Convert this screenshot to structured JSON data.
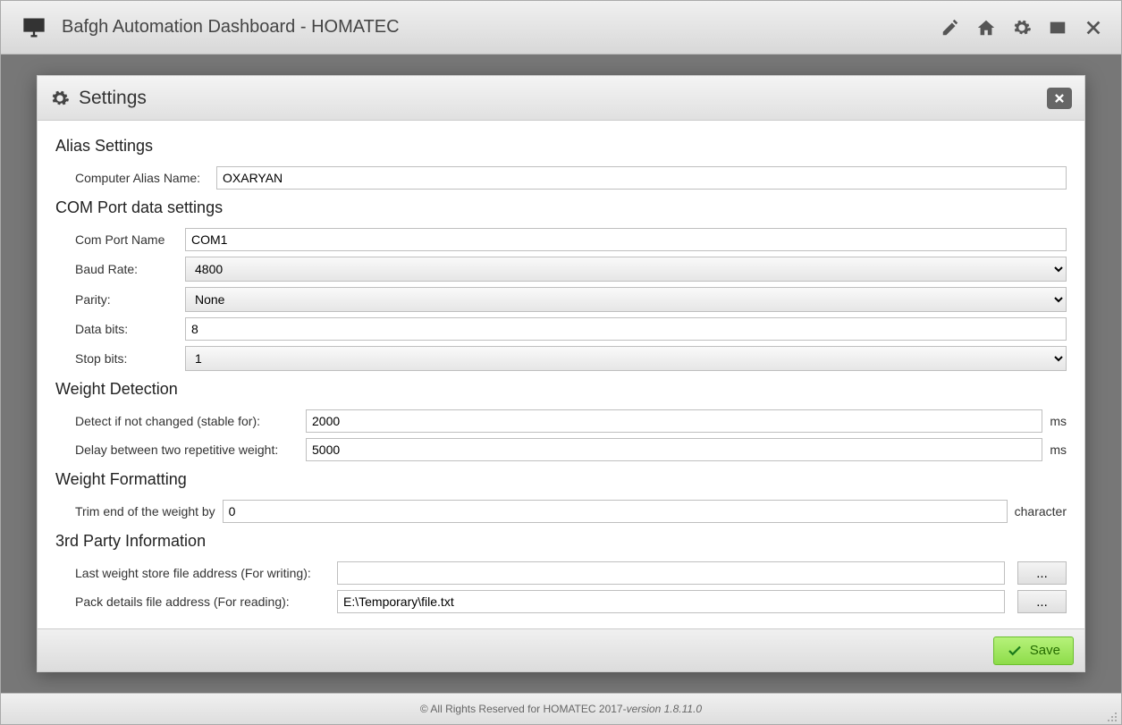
{
  "app": {
    "title": "Bafgh Automation Dashboard - HOMATEC"
  },
  "toolbar_icons": {
    "pencil": "pencil-icon",
    "home": "home-icon",
    "gear": "gear-icon",
    "window": "window-icon",
    "close": "close-icon"
  },
  "modal": {
    "title": "Settings",
    "sections": {
      "alias": {
        "heading": "Alias Settings",
        "computer_alias_label": "Computer Alias Name:",
        "computer_alias_value": "OXARYAN"
      },
      "comport": {
        "heading": "COM Port data settings",
        "port_name_label": "Com Port Name",
        "port_name_value": "COM1",
        "baud_label": "Baud Rate:",
        "baud_value": "4800",
        "parity_label": "Parity:",
        "parity_value": "None",
        "databits_label": "Data bits:",
        "databits_value": "8",
        "stopbits_label": "Stop bits:",
        "stopbits_value": "1"
      },
      "detection": {
        "heading": "Weight Detection",
        "stable_label": "Detect if not changed (stable for):",
        "stable_value": "2000",
        "stable_unit": "ms",
        "delay_label": "Delay between two repetitive weight:",
        "delay_value": "5000",
        "delay_unit": "ms"
      },
      "formatting": {
        "heading": "Weight Formatting",
        "trim_label": "Trim end of the weight by",
        "trim_value": "0",
        "trim_unit": "character"
      },
      "thirdparty": {
        "heading": "3rd Party Information",
        "writefile_label": "Last weight store file address (For writing):",
        "writefile_value": "",
        "readfile_label": "Pack details file address (For reading):",
        "readfile_value": "E:\\Temporary\\file.txt",
        "browse_label": "..."
      }
    },
    "save_label": "Save"
  },
  "footer": {
    "copyright": "© All Rights Reserved for HOMATEC 2017- ",
    "version": "version 1.8.11.0"
  }
}
